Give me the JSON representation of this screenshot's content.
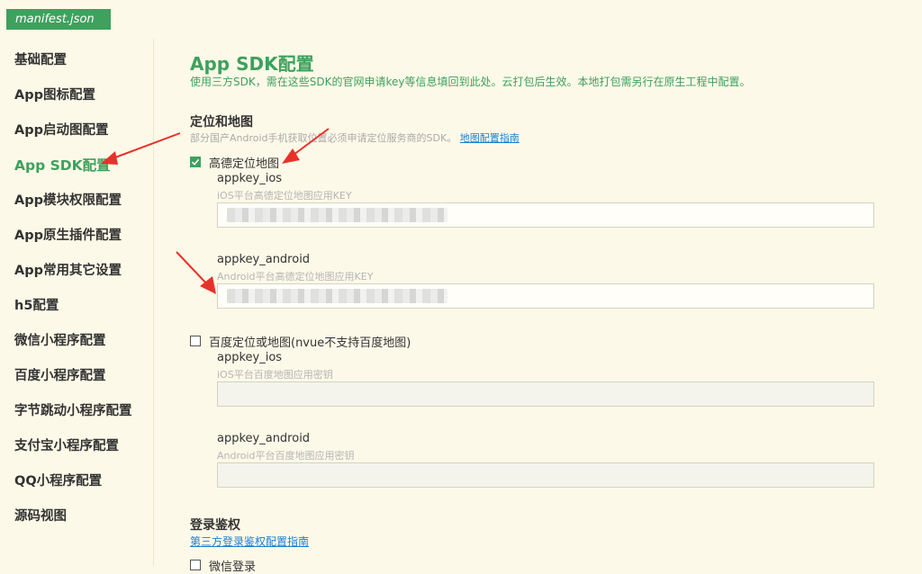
{
  "tab": {
    "label": "manifest.json"
  },
  "sidebar": {
    "items": [
      {
        "label": "基础配置"
      },
      {
        "label": "App图标配置"
      },
      {
        "label": "App启动图配置"
      },
      {
        "label": "App SDK配置"
      },
      {
        "label": "App模块权限配置"
      },
      {
        "label": "App原生插件配置"
      },
      {
        "label": "App常用其它设置"
      },
      {
        "label": "h5配置"
      },
      {
        "label": "微信小程序配置"
      },
      {
        "label": "百度小程序配置"
      },
      {
        "label": "字节跳动小程序配置"
      },
      {
        "label": "支付宝小程序配置"
      },
      {
        "label": "QQ小程序配置"
      },
      {
        "label": "源码视图"
      }
    ]
  },
  "main": {
    "title": "App SDK配置",
    "description": "使用三方SDK，需在这些SDK的官网申请key等信息填回到此处。云打包后生效。本地打包需另行在原生工程中配置。",
    "location": {
      "title": "定位和地图",
      "hint": "部分国产Android手机获取位置必须申请定位服务商的SDK。",
      "hint_link": "地图配置指南",
      "amap": {
        "label": "高德定位地图",
        "checked": true,
        "ios_label": "appkey_ios",
        "ios_hint": "iOS平台高德定位地图应用KEY",
        "android_label": "appkey_android",
        "android_hint": "Android平台高德定位地图应用KEY"
      },
      "baidu": {
        "label": "百度定位或地图(nvue不支持百度地图)",
        "checked": false,
        "ios_label": "appkey_ios",
        "ios_hint": "iOS平台百度地图应用密钥",
        "android_label": "appkey_android",
        "android_hint": "Android平台百度地图应用密钥"
      }
    },
    "login": {
      "title": "登录鉴权",
      "link": "第三方登录鉴权配置指南",
      "weixin_label": "微信登录"
    }
  },
  "colors": {
    "accent": "#3ea15d",
    "background": "#fdf9e8",
    "link": "#1a7ed4",
    "annotation": "#e8312a"
  }
}
